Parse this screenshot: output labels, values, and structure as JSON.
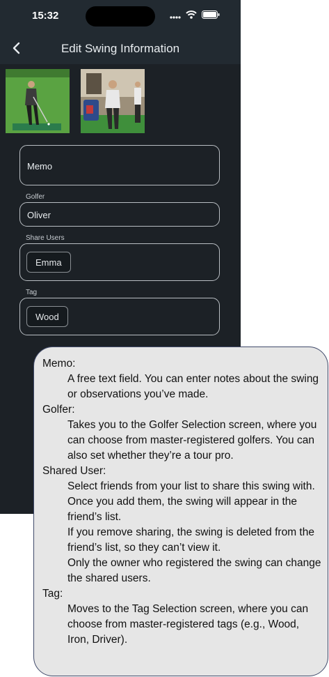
{
  "status_bar": {
    "time": "15:32"
  },
  "header": {
    "title": "Edit Swing Information"
  },
  "form": {
    "memo_placeholder": "Memo",
    "golfer_label": "Golfer",
    "golfer_value": "Oliver",
    "share_label": "Share Users",
    "share_users": [
      "Emma"
    ],
    "tag_label": "Tag",
    "tags": [
      "Wood"
    ]
  },
  "annotation": [
    {
      "heading": "Memo:",
      "lines": [
        "A free text field. You can enter notes about the swing or observations you’ve made."
      ]
    },
    {
      "heading": "Golfer:",
      "lines": [
        "Takes you to the Golfer Selection screen, where you can choose from master-registered golfers. You can also set whether they’re a tour pro."
      ]
    },
    {
      "heading": "Shared User:",
      "lines": [
        "Select friends from your list to share this swing with.",
        "Once you add them, the swing will appear in the friend’s list.",
        "If you remove sharing, the swing is deleted from the friend’s list, so they can’t view it.",
        "Only the owner who registered the swing can change the shared users."
      ]
    },
    {
      "heading": "Tag:",
      "lines": [
        "Moves to the Tag Selection screen, where you can choose from master-registered tags (e.g., Wood, Iron, Driver)."
      ]
    }
  ]
}
